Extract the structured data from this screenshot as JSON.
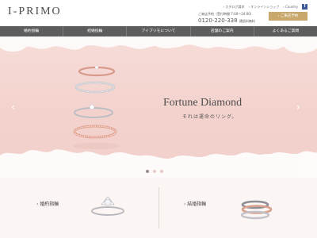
{
  "header": {
    "logo": "I-PRIMO",
    "top_links": [
      "› カタログ請求",
      "› オンラインショップ",
      "› Country"
    ],
    "facebook_icon": "f",
    "contact_hours": "ご来店予約（受付時間 7:00～24:00）",
    "contact_tel": "0120-220-338",
    "contact_tel_note": "通話料無料",
    "reserve_label": "› ご来店予約"
  },
  "nav": {
    "items": [
      "婚約指輪",
      "結婚指輪",
      "アイプリモについて",
      "店舗のご案内",
      "よくあるご質問"
    ]
  },
  "hero": {
    "title": "Fortune Diamond",
    "subtitle": "それは運命のリング。",
    "prev_glyph": "‹",
    "next_glyph": "›",
    "slide_count": 3,
    "active_slide": 1,
    "colors": {
      "background": "#f3d2cd",
      "lace": "#ffffff"
    }
  },
  "cards": [
    {
      "label": "› 婚約指輪"
    },
    {
      "label": "› 結婚指輪"
    }
  ],
  "colors": {
    "nav_bg": "#5d5d5d",
    "accent_gold": "#c9a96b",
    "facebook": "#3b5998"
  }
}
